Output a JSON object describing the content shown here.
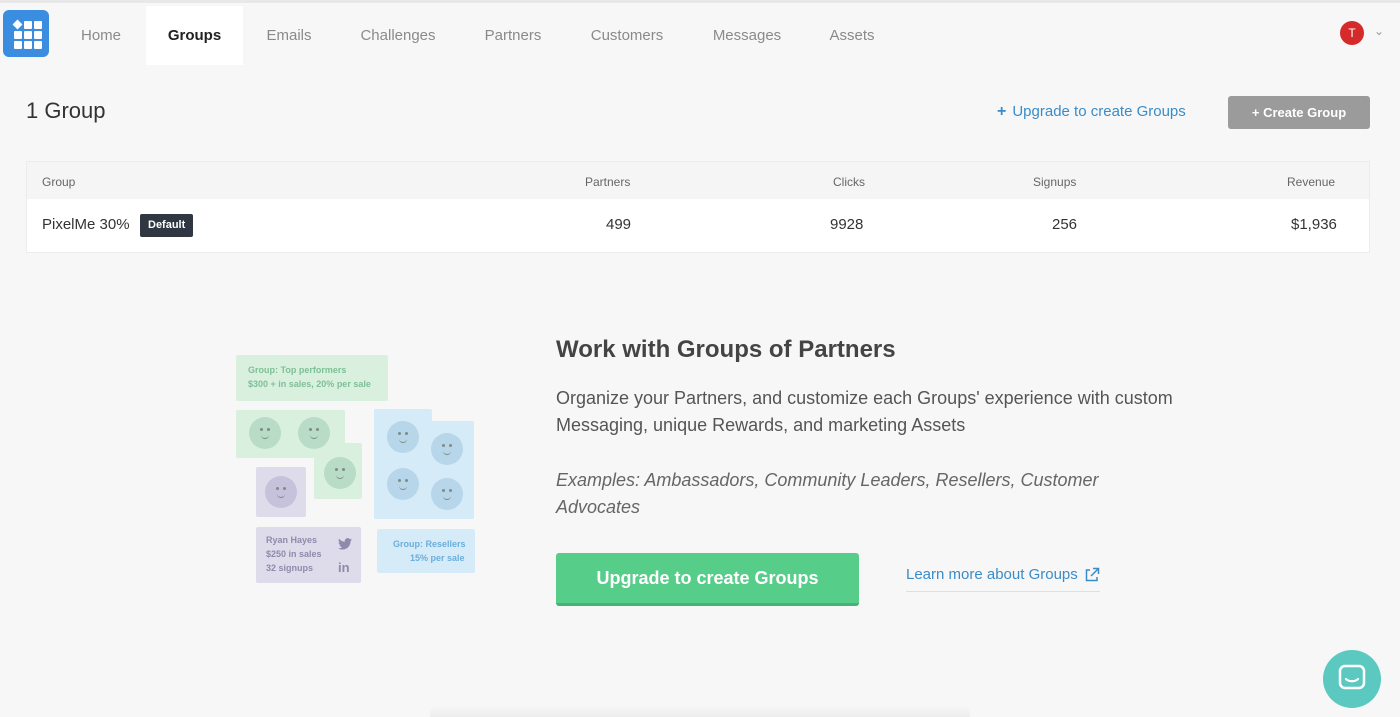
{
  "nav": {
    "items": [
      {
        "label": "Home",
        "active": false
      },
      {
        "label": "Groups",
        "active": true
      },
      {
        "label": "Emails",
        "active": false
      },
      {
        "label": "Challenges",
        "active": false
      },
      {
        "label": "Partners",
        "active": false
      },
      {
        "label": "Customers",
        "active": false
      },
      {
        "label": "Messages",
        "active": false
      },
      {
        "label": "Assets",
        "active": false
      }
    ],
    "avatar_initial": "T",
    "avatar_color": "#d52a2a"
  },
  "header": {
    "title": "1 Group",
    "upgrade_link": "Upgrade to create Groups",
    "create_button": "+ Create Group"
  },
  "table": {
    "columns": [
      "Group",
      "Partners",
      "Clicks",
      "Signups",
      "Revenue"
    ],
    "rows": [
      {
        "group": "PixelMe 30%",
        "badge": "Default",
        "partners": "499",
        "clicks": "9928",
        "signups": "256",
        "revenue": "$1,936"
      }
    ]
  },
  "illustration": {
    "top_card_line1": "Group: Top performers",
    "top_card_line2": "$300 + in sales, 20% per sale",
    "person_name": "Ryan Hayes",
    "person_sales": "$250 in sales",
    "person_signups": "32 signups",
    "resellers_line1": "Group: Resellers",
    "resellers_line2": "15% per sale",
    "linkedin_text": "in"
  },
  "promo": {
    "title": "Work with Groups of Partners",
    "description": "Organize your Partners, and customize each Groups' experience with custom Messaging, unique Rewards, and marketing Assets",
    "examples": "Examples: Ambassadors, Community Leaders, Resellers, Customer Advocates",
    "button": "Upgrade to create Groups",
    "learn_more": "Learn more about Groups"
  },
  "colors": {
    "accent_blue": "#3a8cc8",
    "green_button": "#57cd8a",
    "chat": "#5cc9c1"
  }
}
